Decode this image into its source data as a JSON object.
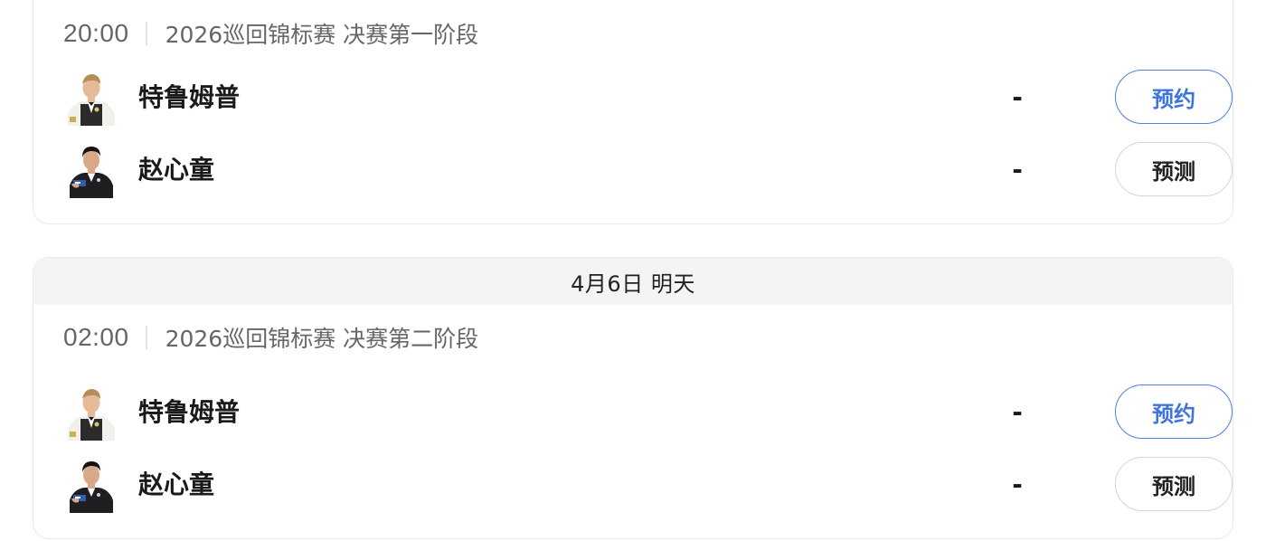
{
  "colors": {
    "accent_blue": "#3f74de",
    "header_bg": "#f3f4f6",
    "muted_text": "#666666"
  },
  "matches": [
    {
      "date_header": "",
      "time": "20:00",
      "event": "2026巡回锦标赛 决赛第一阶段",
      "players": [
        {
          "name": "特鲁姆普",
          "score": "-",
          "avatar_icon": "player-avatar-icon"
        },
        {
          "name": "赵心童",
          "score": "-",
          "avatar_icon": "player-avatar-icon"
        }
      ],
      "buttons": {
        "reserve": "预约",
        "predict": "预测"
      }
    },
    {
      "date_header": "4月6日 明天",
      "time": "02:00",
      "event": "2026巡回锦标赛 决赛第二阶段",
      "players": [
        {
          "name": "特鲁姆普",
          "score": "-",
          "avatar_icon": "player-avatar-icon"
        },
        {
          "name": "赵心童",
          "score": "-",
          "avatar_icon": "player-avatar-icon"
        }
      ],
      "buttons": {
        "reserve": "预约",
        "predict": "预测"
      }
    }
  ]
}
